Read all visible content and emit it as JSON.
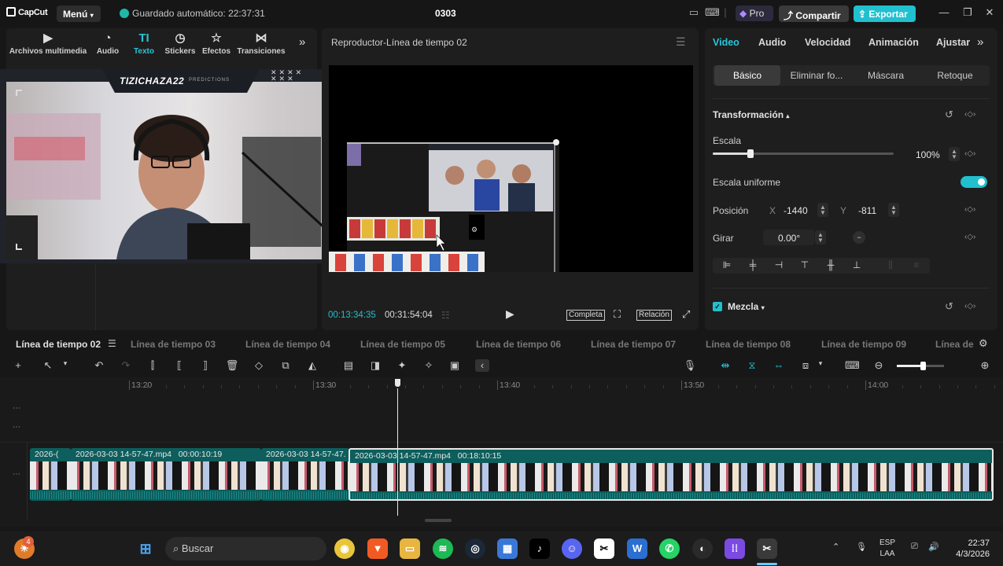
{
  "titlebar": {
    "app_name": "CapCut",
    "menu_label": "Menú",
    "autosave": "Guardado automático: 22:37:31",
    "project_title": "0303",
    "pro_label": "Pro",
    "share_label": "Compartir",
    "export_label": "Exportar"
  },
  "media_tools": [
    {
      "label": "Archivos multimedia",
      "icon": "media-icon"
    },
    {
      "label": "Audio",
      "icon": "audio-icon"
    },
    {
      "label": "Texto",
      "icon": "text-icon",
      "active": true
    },
    {
      "label": "Stickers",
      "icon": "sticker-icon"
    },
    {
      "label": "Efectos",
      "icon": "effects-icon"
    },
    {
      "label": "Transiciones",
      "icon": "transitions-icon"
    }
  ],
  "webcam_overlay": {
    "name": "TIZICHAZA22",
    "sub": "PREDICTIONS"
  },
  "player": {
    "title": "Reproductor-Línea de tiempo 02",
    "current_time": "00:13:34:35",
    "total_time": "00:31:54:04",
    "full_label": "Completa",
    "ratio_label": "Relación"
  },
  "inspector": {
    "tabs": [
      "Video",
      "Audio",
      "Velocidad",
      "Animación",
      "Ajustar"
    ],
    "active_tab": "Video",
    "subtabs": [
      "Básico",
      "Eliminar fo...",
      "Máscara",
      "Retoque"
    ],
    "transform_title": "Transformación",
    "scale_label": "Escala",
    "scale_value": "100%",
    "scale_fraction": 0.21,
    "uniform_scale_label": "Escala uniforme",
    "uniform_scale_on": true,
    "position_label": "Posición",
    "pos_x_label": "X",
    "pos_x": "-1440",
    "pos_y_label": "Y",
    "pos_y": "-811",
    "rotate_label": "Girar",
    "rotate_value": "0.00°",
    "blend_label": "Mezcla"
  },
  "timeline_tabs": [
    "Línea de tiempo 02",
    "Línea de tiempo 03",
    "Línea de tiempo 04",
    "Línea de tiempo 05",
    "Línea de tiempo 06",
    "Línea de tiempo 07",
    "Línea de tiempo 08",
    "Línea de tiempo 09",
    "Línea de"
  ],
  "ruler": [
    "13:20",
    "13:30",
    "13:40",
    "13:50",
    "14:00"
  ],
  "clips": [
    {
      "label": "2026-("
    },
    {
      "label": "2026-03-03 14-57-47.mp4",
      "duration": "00:00:10:19"
    },
    {
      "label": "2026-03-03 14-57-47."
    },
    {
      "label": "2026-03-03 14-57-47.mp4",
      "duration": "00:18:10:15"
    }
  ],
  "taskbar": {
    "search_placeholder": "Buscar",
    "lang_top": "ESP",
    "lang_bottom": "LAA",
    "time": "22:37",
    "date": "4/3/2026",
    "badge_count": "4"
  },
  "colors": {
    "accent": "#21c0cf",
    "clip": "#0d5e5c",
    "panel": "#1e1e1e"
  }
}
